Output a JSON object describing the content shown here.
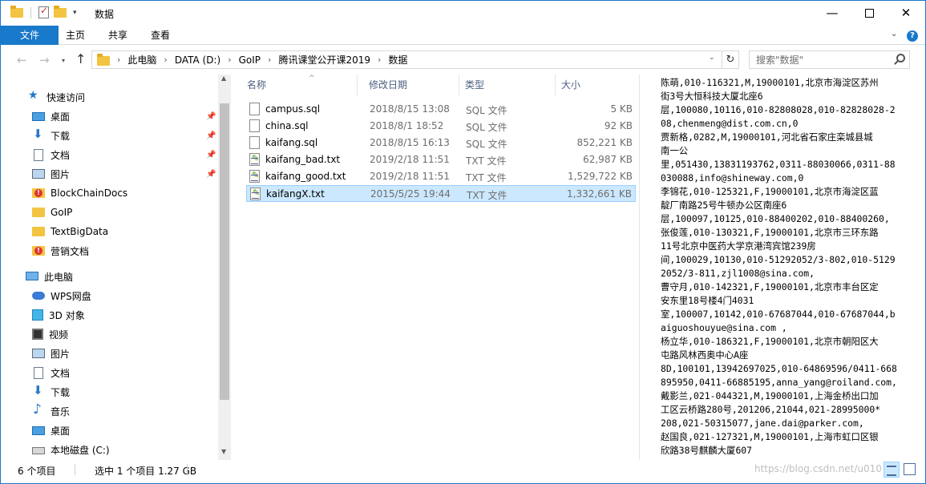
{
  "window": {
    "title": "数据",
    "min_glyph": "—",
    "close_glyph": "✕"
  },
  "ribbon": {
    "tabs": [
      "文件",
      "主页",
      "共享",
      "查看"
    ],
    "expand_glyph": "⌄",
    "help_glyph": "?"
  },
  "address": {
    "breadcrumb": [
      "此电脑",
      "DATA (D:)",
      "GoIP",
      "腾讯课堂公开课2019",
      "数据"
    ],
    "search_placeholder": "搜索\"数据\""
  },
  "nav": {
    "quick_access_label": "快速访问",
    "quick_items": [
      {
        "label": "桌面",
        "icon": "desktop-icon",
        "pinned": true
      },
      {
        "label": "下载",
        "icon": "download-icon",
        "pinned": true
      },
      {
        "label": "文档",
        "icon": "document-icon",
        "pinned": true
      },
      {
        "label": "图片",
        "icon": "pictures-icon",
        "pinned": true
      },
      {
        "label": "BlockChainDocs",
        "icon": "folder-icon"
      },
      {
        "label": "GoIP",
        "icon": "folder-icon"
      },
      {
        "label": "TextBigData",
        "icon": "folder-icon"
      },
      {
        "label": "营销文档",
        "icon": "folder-icon"
      }
    ],
    "this_pc_label": "此电脑",
    "pc_items": [
      {
        "label": "WPS网盘",
        "icon": "cloud-icon"
      },
      {
        "label": "3D 对象",
        "icon": "3d-objects-icon"
      },
      {
        "label": "视频",
        "icon": "video-icon"
      },
      {
        "label": "图片",
        "icon": "pictures-icon"
      },
      {
        "label": "文档",
        "icon": "document-icon"
      },
      {
        "label": "下载",
        "icon": "download-icon"
      },
      {
        "label": "音乐",
        "icon": "music-icon"
      },
      {
        "label": "桌面",
        "icon": "desktop-icon"
      },
      {
        "label": "本地磁盘 (C:)",
        "icon": "drive-icon"
      }
    ]
  },
  "columns": {
    "name": "名称",
    "date": "修改日期",
    "type": "类型",
    "size": "大小"
  },
  "files": [
    {
      "name": "campus.sql",
      "date": "2018/8/15 13:08",
      "type": "SQL 文件",
      "size": "5 KB",
      "icon": "sql-file-icon"
    },
    {
      "name": "china.sql",
      "date": "2018/8/1 18:52",
      "type": "SQL 文件",
      "size": "92 KB",
      "icon": "sql-file-icon"
    },
    {
      "name": "kaifang.sql",
      "date": "2018/8/15 16:13",
      "type": "SQL 文件",
      "size": "852,221 KB",
      "icon": "sql-file-icon"
    },
    {
      "name": "kaifang_bad.txt",
      "date": "2019/2/18 11:51",
      "type": "TXT 文件",
      "size": "62,987 KB",
      "icon": "txt-file-icon"
    },
    {
      "name": "kaifang_good.txt",
      "date": "2019/2/18 11:51",
      "type": "TXT 文件",
      "size": "1,529,722 KB",
      "icon": "txt-file-icon"
    },
    {
      "name": "kaifangX.txt",
      "date": "2015/5/25 19:44",
      "type": "TXT 文件",
      "size": "1,332,661 KB",
      "icon": "txt-file-icon",
      "selected": true
    }
  ],
  "preview_lines": [
    "陈萌,010-116321,M,19000101,北京市海淀区苏州",
    "街3号大恒科技大厦北座6",
    "层,100080,10116,010-82808028,010-82828028-2",
    "08,chenmeng@dist.com.cn,0",
    "贾新格,0282,M,19000101,河北省石家庄栾城县城",
    "南一公",
    "里,051430,13831193762,0311-88030066,0311-88",
    "030088,info@shineway.com,0",
    "李锦花,010-125321,F,19000101,北京市海淀区蓝",
    "靛厂南路25号牛顿办公区南座6",
    "层,100097,10125,010-88400202,010-88400260,",
    "张俊莲,010-130321,F,19000101,北京市三环东路",
    "11号北京中医药大学京港湾宾馆239房",
    "间,100029,10130,010-51292052/3-802,010-5129",
    "2052/3-811,zjl1008@sina.com,",
    "曹守月,010-142321,F,19000101,北京市丰台区定",
    "安东里18号楼4门4031",
    "室,100007,10142,010-67687044,010-67687044,b",
    "aiguoshouyue@sina.com ,",
    "杨立华,010-186321,F,19000101,北京市朝阳区大",
    "屯路风林西奥中心A座",
    "8D,100101,13942697025,010-64869596/0411-668",
    "895950,0411-66885195,anna_yang@roiland.com,",
    "戴影兰,021-044321,M,19000101,上海金桥出口加",
    "工区云桥路280号,201206,21044,021-28995000*",
    "208,021-50315077,jane.dai@parker.com,",
    "赵国良,021-127321,M,19000101,上海市虹口区银",
    "欣路38号麒麟大厦607"
  ],
  "status": {
    "count": "6 个项目",
    "selected": "选中 1 个项目  1.27 GB"
  },
  "watermark": "https://blog.csdn.net/u010"
}
